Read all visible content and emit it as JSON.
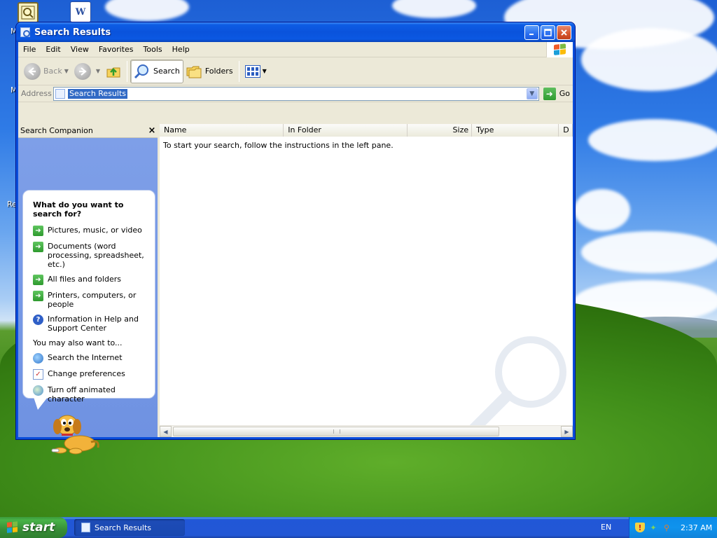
{
  "window": {
    "title": "Search Results"
  },
  "menu": [
    "File",
    "Edit",
    "View",
    "Favorites",
    "Tools",
    "Help"
  ],
  "toolbar": {
    "back_label": "Back",
    "search_label": "Search",
    "folders_label": "Folders"
  },
  "address": {
    "label": "Address",
    "value": "Search Results",
    "go_label": "Go"
  },
  "companion": {
    "title": "Search Companion",
    "prompt": "What do you want to search for?",
    "options": [
      "Pictures, music, or video",
      "Documents (word processing, spreadsheet, etc.)",
      "All files and folders",
      "Printers, computers, or people",
      "Information in Help and Support Center"
    ],
    "also_label": "You may also want to...",
    "also_options": [
      "Search the Internet",
      "Change preferences",
      "Turn off animated character"
    ]
  },
  "results": {
    "columns": [
      "Name",
      "In Folder",
      "Size",
      "Type",
      "D"
    ],
    "empty_message": "To start your search, follow the instructions in the left pane."
  },
  "taskbar": {
    "start_label": "start",
    "task_label": "Search Results",
    "language": "EN",
    "clock": "2:37 AM"
  },
  "desktop": {
    "edge_labels": [
      "M",
      "M",
      "Re"
    ]
  },
  "colors": {
    "title_blue": "#0a53dc",
    "start_green": "#3c9a3c",
    "tray_blue": "#0f93ed",
    "companion_blue": "#6f92e2"
  }
}
